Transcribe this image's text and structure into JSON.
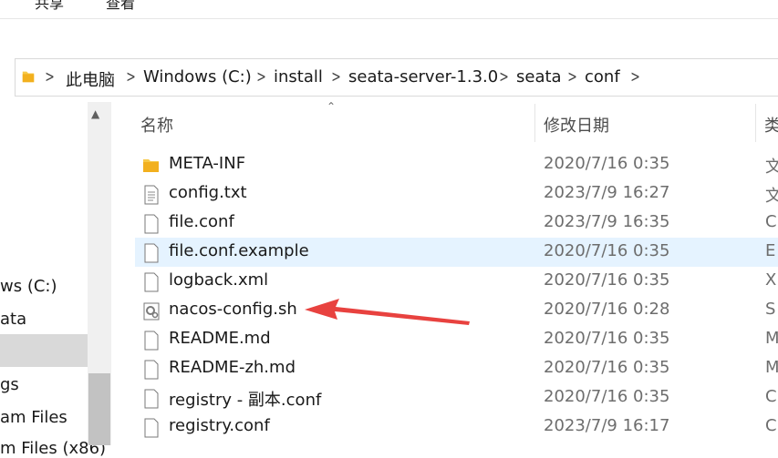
{
  "ribbon": {
    "tabs": [
      "共享",
      "查看"
    ]
  },
  "breadcrumb": {
    "items": [
      "此电脑",
      "Windows (C:)",
      "install",
      "seata-server-1.3.0",
      "seata",
      "conf"
    ]
  },
  "nav": {
    "items": [
      "ws (C:)",
      "ata",
      "gs",
      "am Files",
      "m Files (x86)"
    ]
  },
  "columns": {
    "name": "名称",
    "date": "修改日期",
    "type": "类"
  },
  "files": [
    {
      "name": "META-INF",
      "date": "2020/7/16 0:35",
      "type": "文",
      "icon": "folder-icon"
    },
    {
      "name": "config.txt",
      "date": "2023/7/9 16:27",
      "type": "文",
      "icon": "text-file-icon"
    },
    {
      "name": "file.conf",
      "date": "2023/7/9 16:35",
      "type": "C",
      "icon": "file-icon"
    },
    {
      "name": "file.conf.example",
      "date": "2020/7/16 0:35",
      "type": "E",
      "icon": "file-icon"
    },
    {
      "name": "logback.xml",
      "date": "2020/7/16 0:35",
      "type": "X",
      "icon": "file-icon"
    },
    {
      "name": "nacos-config.sh",
      "date": "2020/7/16 0:28",
      "type": "S",
      "icon": "script-file-icon"
    },
    {
      "name": "README.md",
      "date": "2020/7/16 0:35",
      "type": "M",
      "icon": "file-icon"
    },
    {
      "name": "README-zh.md",
      "date": "2020/7/16 0:35",
      "type": "M",
      "icon": "file-icon"
    },
    {
      "name": "registry - 副本.conf",
      "date": "2020/7/16 0:35",
      "type": "C",
      "icon": "file-icon"
    },
    {
      "name": "registry.conf",
      "date": "2023/7/9 16:17",
      "type": "C",
      "icon": "file-icon"
    }
  ],
  "colors": {
    "highlight_row": "#e5f3ff",
    "annotation_arrow": "#e8423f",
    "folder": "#f7c948"
  }
}
